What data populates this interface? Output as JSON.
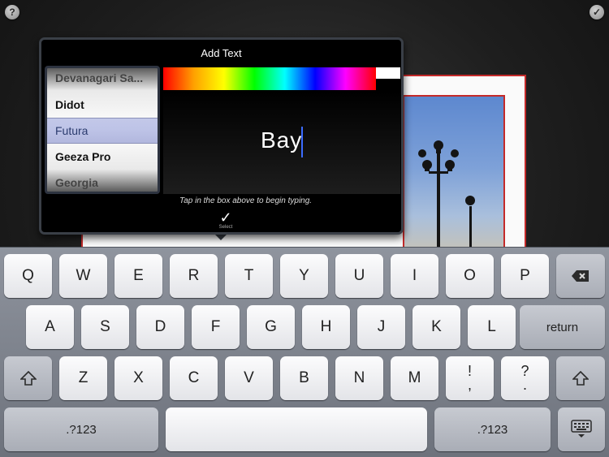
{
  "toolbar": {
    "help_label": "?",
    "done_label": "✓"
  },
  "popover": {
    "title": "Add Text",
    "fonts": [
      "Devanagari Sa...",
      "Didot",
      "Futura",
      "Geeza Pro",
      "Georgia"
    ],
    "selected_font": "Futura",
    "text_value": "Bay",
    "hint": "Tap in the box above to begin typing.",
    "select_label": "Select",
    "colors": {
      "accent": "#3b6bff",
      "popover_border": "#3a3f47"
    }
  },
  "keyboard": {
    "row1": [
      "Q",
      "W",
      "E",
      "R",
      "T",
      "Y",
      "U",
      "I",
      "O",
      "P"
    ],
    "row2": [
      "A",
      "S",
      "D",
      "F",
      "G",
      "H",
      "J",
      "K",
      "L"
    ],
    "row3": [
      "Z",
      "X",
      "C",
      "V",
      "B",
      "N",
      "M"
    ],
    "return_label": "return",
    "numbers_label": ".?123",
    "exclaim_top": "!",
    "exclaim_bottom": ",",
    "question_top": "?",
    "question_bottom": ".",
    "icons": {
      "backspace": "backspace-icon",
      "shift": "shift-icon",
      "dismiss": "keyboard-dismiss-icon"
    }
  }
}
